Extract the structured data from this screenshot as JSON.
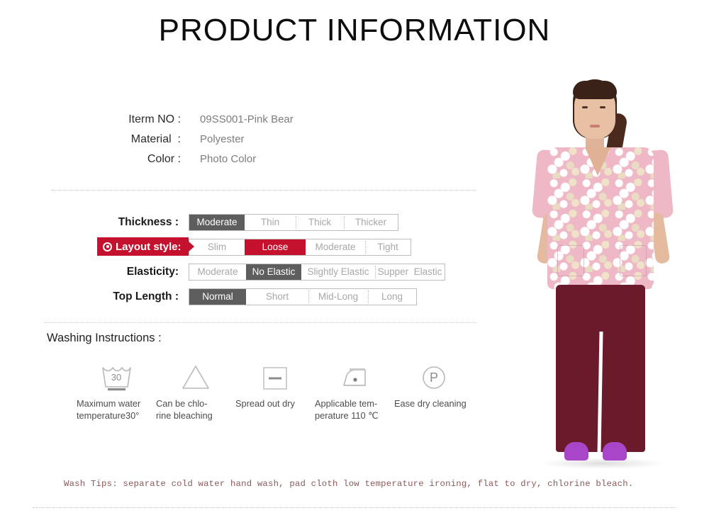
{
  "page": {
    "title": "PRODUCT INFORMATION"
  },
  "specs": [
    {
      "key": "Iterm NO :",
      "value": "09SS001-Pink Bear"
    },
    {
      "key": "Material  :",
      "value": "Polyester"
    },
    {
      "key": "Color :",
      "value": "Photo Color"
    }
  ],
  "attributes": [
    {
      "label": "Thickness :",
      "highlighted": false,
      "options": [
        "Moderate",
        "Thin",
        "Thick",
        "Thicker"
      ],
      "selected": "Moderate",
      "widths": [
        78,
        72,
        68,
        76
      ]
    },
    {
      "label": "Layout style:",
      "highlighted": true,
      "options": [
        "Slim",
        "Loose",
        "Moderate",
        "Tight"
      ],
      "selected": "Loose",
      "widths": [
        78,
        86,
        84,
        64
      ]
    },
    {
      "label": "Elasticity:",
      "highlighted": false,
      "options": [
        "Moderate",
        "No Elastic",
        "Slightly Elastic",
        "Supper  Elastic"
      ],
      "selected": "No Elastic",
      "widths": [
        80,
        78,
        104,
        98
      ]
    },
    {
      "label": "Top Length :",
      "highlighted": false,
      "options": [
        "Normal",
        "Short",
        "Mid-Long",
        "Long"
      ],
      "selected": "Normal",
      "widths": [
        80,
        88,
        84,
        68
      ]
    }
  ],
  "washing": {
    "heading": "Washing Instructions :",
    "items": [
      {
        "icon": "wash-tub-30-icon",
        "label": "Maximum water\ntemperature30°",
        "temp": "30"
      },
      {
        "icon": "bleach-triangle-icon",
        "label": "Can be chlo-\nrine bleaching"
      },
      {
        "icon": "flat-dry-square-icon",
        "label": "Spread out dry"
      },
      {
        "icon": "iron-one-dot-icon",
        "label": "Applicable tem-\nperature 110 ℃"
      },
      {
        "icon": "dry-clean-p-icon",
        "label": "Ease dry cleaning",
        "letter": "P"
      }
    ]
  },
  "wash_tips": "Wash Tips: separate cold water hand wash, pad cloth low temperature ironing, flat to dry, chlorine bleach.",
  "colors": {
    "accent_red": "#C4112E",
    "selected_gray": "#5e5e5e",
    "chip_text": "#a8a8a8",
    "tips_text": "#8a5a5a",
    "pants": "#6b1a2c",
    "shoes": "#a845c8",
    "top_print": "#eeb8c6"
  },
  "model": {
    "alt": "female-model-wearing-pink-bear-print-scrub-top-and-burgundy-pants"
  }
}
